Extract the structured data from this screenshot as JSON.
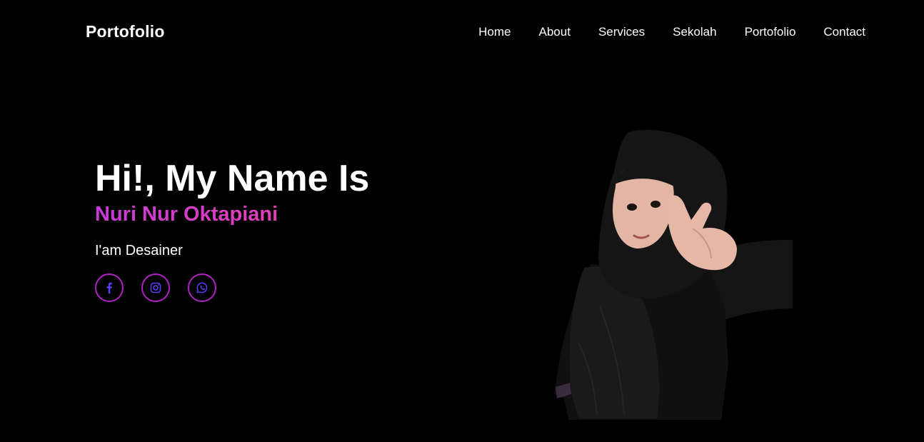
{
  "header": {
    "brand": "Portofolio",
    "nav": [
      {
        "label": "Home"
      },
      {
        "label": "About"
      },
      {
        "label": "Services"
      },
      {
        "label": "Sekolah"
      },
      {
        "label": "Portofolio"
      },
      {
        "label": "Contact"
      }
    ]
  },
  "hero": {
    "heading": "Hi!, My Name Is",
    "name": "Nuri Nur Oktapiani",
    "role": "I'am Desainer",
    "socials": [
      {
        "icon": "facebook-icon"
      },
      {
        "icon": "instagram-icon"
      },
      {
        "icon": "whatsapp-icon"
      }
    ]
  },
  "colors": {
    "background": "#000000",
    "accent_pink": "#d63bc9",
    "icon_border": "#b021c4",
    "icon_color": "#5b3cf0"
  }
}
